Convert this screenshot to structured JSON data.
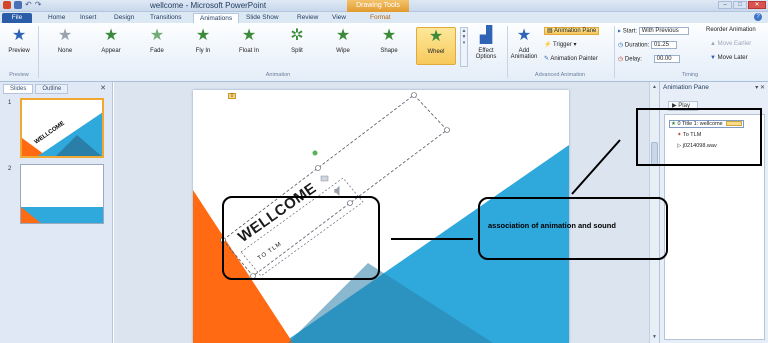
{
  "window": {
    "title": "wellcome - Microsoft PowerPoint",
    "contextual_tab_header": "Drawing Tools"
  },
  "tabs": [
    "File",
    "Home",
    "Insert",
    "Design",
    "Transitions",
    "Animations",
    "Slide Show",
    "Review",
    "View",
    "Format"
  ],
  "active_tab": "Animations",
  "ribbon": {
    "preview_label": "Preview",
    "preview_group": "Preview",
    "animations_group": "Animation",
    "advanced_group": "Advanced Animation",
    "timing_group": "Timing",
    "effects": [
      "None",
      "Appear",
      "Fade",
      "Fly In",
      "Float In",
      "Split",
      "Wipe",
      "Shape",
      "Wheel"
    ],
    "selected_effect": "Wheel",
    "effect_options": "Effect Options",
    "add_animation": "Add Animation",
    "animation_pane": "Animation Pane",
    "trigger": "Trigger",
    "animation_painter": "Animation Painter",
    "start_label": "Start:",
    "start_value": "With Previous",
    "duration_label": "Duration:",
    "duration_value": "01.25",
    "delay_label": "Delay:",
    "delay_value": "00.00",
    "reorder_title": "Reorder Animation",
    "move_earlier": "Move Earlier",
    "move_later": "Move Later"
  },
  "left_panel": {
    "tabs": [
      "Slides",
      "Outline"
    ],
    "active_tab": "Slides",
    "slide_numbers": [
      "1",
      "2"
    ]
  },
  "slide": {
    "title_text": "WELLCOME",
    "subtitle_text": "TO TLM"
  },
  "animation_pane": {
    "title": "Animation Pane",
    "play_label": "Play",
    "items": [
      {
        "label": "0 Title 1: wellcome",
        "selected": true
      },
      {
        "label": "To TLM",
        "selected": false
      },
      {
        "label": "j0214098.wav",
        "selected": false
      }
    ]
  },
  "annotation": {
    "text": "association of animation and sound"
  },
  "colors": {
    "slide_orange": "#ff6a13",
    "slide_blue": "#2fa8dc",
    "slide_teal": "#2a7fa8",
    "selection_highlight": "#f7c95b",
    "file_tab": "#2a5ca8"
  }
}
